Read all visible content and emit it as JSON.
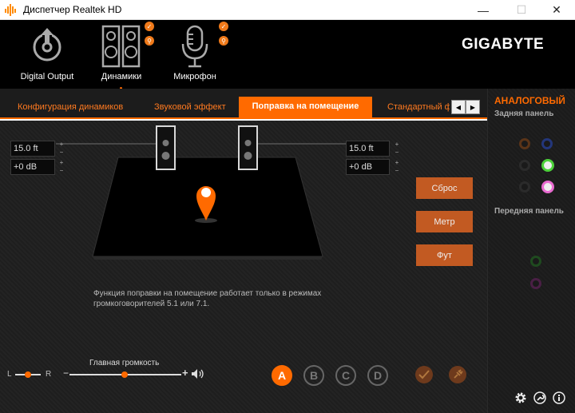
{
  "window": {
    "title": "Диспетчер Realtek HD",
    "min_icon": "—",
    "max_icon": "☐",
    "close_icon": "✕"
  },
  "header": {
    "devices": [
      {
        "label": "Digital Output",
        "icon": "digital-output-icon"
      },
      {
        "label": "Динамики",
        "icon": "speakers-icon"
      },
      {
        "label": "Микрофон",
        "icon": "microphone-icon"
      }
    ],
    "brand": "GIGABYTE"
  },
  "tabs": [
    {
      "label": "Конфигурация динамиков"
    },
    {
      "label": "Звуковой эффект"
    },
    {
      "label": "Поправка на помещение"
    },
    {
      "label": "Стандартный формат"
    }
  ],
  "room": {
    "left_distance": "15.0 ft",
    "left_gain": "+0 dB",
    "right_distance": "15.0 ft",
    "right_gain": "+0 dB",
    "spin_up": "+",
    "spin_down": "−"
  },
  "buttons": {
    "reset": "Сброс",
    "meter": "Метр",
    "foot": "Фут"
  },
  "note": "Функция поправки на помещение работает только в режимах громкоговорителей 5.1 или 7.1.",
  "volume": {
    "label": "Главная громкость",
    "balance_left": "L",
    "balance_right": "R",
    "minus": "−",
    "plus": "+"
  },
  "profiles": [
    "A",
    "B",
    "C",
    "D"
  ],
  "side": {
    "title": "АНАЛОГОВЫЙ",
    "rear": "Задняя панель",
    "front": "Передняя панель"
  },
  "colors": {
    "accent": "#ff6a00",
    "tab_active": "#ff6a00",
    "jack_green": "#4cd13a",
    "jack_pink": "#e86bd0",
    "jack_blue": "#2b4fbf",
    "jack_orange": "#c46018"
  }
}
